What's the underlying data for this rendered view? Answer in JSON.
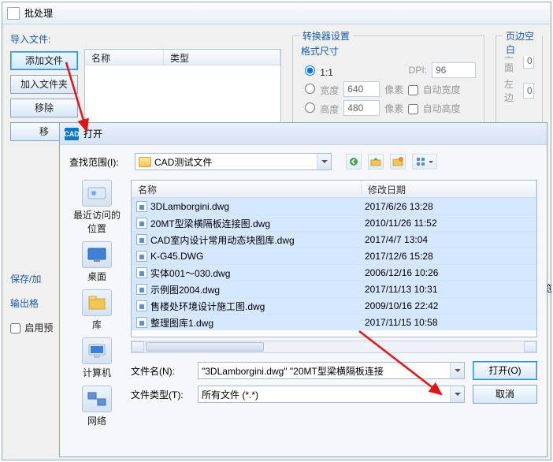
{
  "backWindow": {
    "title": "批处理",
    "importLabel": "导入文件:",
    "btnAddFile": "添加文件",
    "btnAddFolder": "加入文件夹",
    "btnRemove": "移除",
    "btnMove": "移",
    "listCols": {
      "name": "名称",
      "type": "类型"
    },
    "saveLabel": "保存/加",
    "outputLabel": "输出格",
    "enablePreviewCk": "启用预",
    "converter": {
      "legend": "转换器设置",
      "formatLabel": "格式尺寸",
      "ratioLabel": "1:1",
      "dpiLabel": "DPI:",
      "dpiValue": "96",
      "widthLabel": "宽度",
      "widthValue": "640",
      "heightLabel": "高度",
      "heightValue": "480",
      "px": "像素",
      "autoWidth": "自动宽度",
      "autoHeight": "自动高度"
    },
    "margins": {
      "legend": "页边空白",
      "top": "上面",
      "topV": "0",
      "left": "左边",
      "leftV": "0"
    },
    "enablePreview": "启用预览"
  },
  "openDialog": {
    "title": "打开",
    "lookInLabel": "查找范围(I):",
    "folder": "CAD测试文件",
    "places": {
      "recent": "最近访问的位置",
      "desktop": "桌面",
      "libraries": "库",
      "computer": "计算机",
      "network": "网络"
    },
    "cols": {
      "name": "名称",
      "date": "修改日期"
    },
    "files": [
      {
        "name": "3DLamborgini.dwg",
        "date": "2017/6/26 13:28"
      },
      {
        "name": "20MT型梁横隔板连接图.dwg",
        "date": "2010/11/26 11:52"
      },
      {
        "name": "CAD室内设计常用动态块图库.dwg",
        "date": "2017/4/7 13:04"
      },
      {
        "name": "K-G45.DWG",
        "date": "2017/12/6 15:28"
      },
      {
        "name": "实体001～030.dwg",
        "date": "2006/12/16 10:26"
      },
      {
        "name": "示例图2004.dwg",
        "date": "2017/11/13 10:31"
      },
      {
        "name": "售楼处环境设计施工图.dwg",
        "date": "2009/10/16 22:42"
      },
      {
        "name": "整理图库1.dwg",
        "date": "2017/11/15 10:58"
      }
    ],
    "fileNameLabel": "文件名(N):",
    "fileNameValue": "\"3DLamborgini.dwg\" \"20MT型梁横隔板连接",
    "fileTypeLabel": "文件类型(T):",
    "fileTypeValue": "所有文件 (*.*)",
    "openBtn": "打开(O)",
    "cancelBtn": "取消"
  }
}
